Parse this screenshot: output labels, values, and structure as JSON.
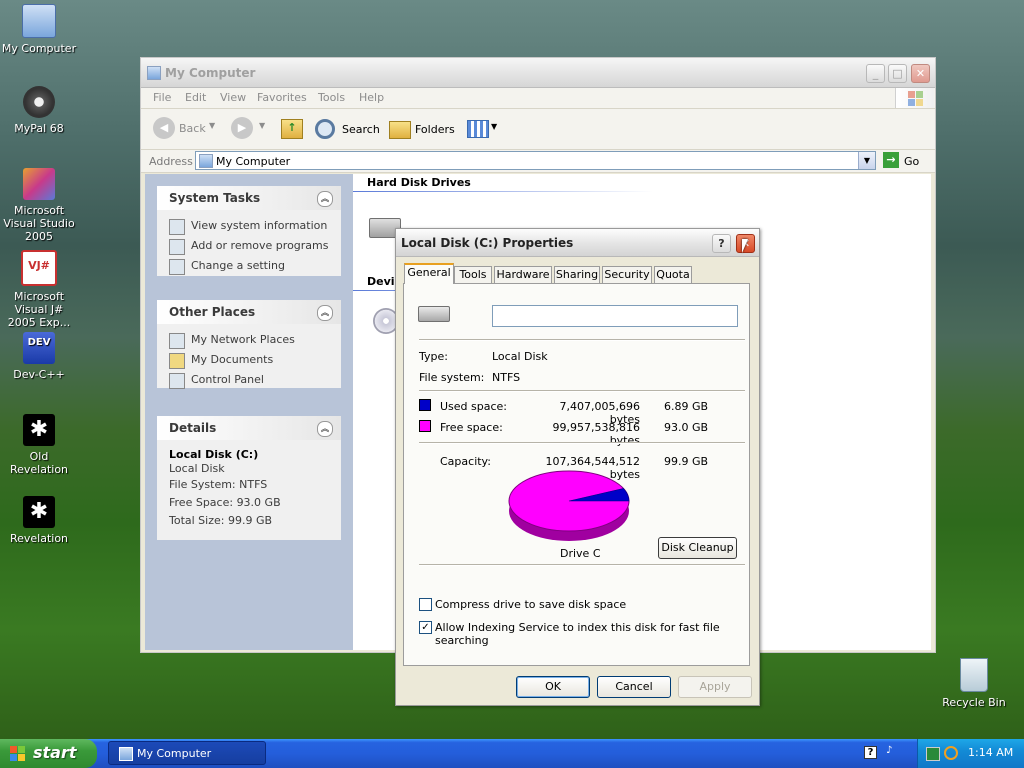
{
  "desktop": {
    "icons": [
      {
        "label": "My Computer"
      },
      {
        "label": "MyPal 68"
      },
      {
        "label": "Microsoft Visual Studio 2005"
      },
      {
        "label": "Microsoft Visual J# 2005 Exp..."
      },
      {
        "label": "Dev-C++"
      },
      {
        "label": "Old Revelation"
      },
      {
        "label": "Revelation"
      },
      {
        "label": "Recycle Bin"
      }
    ]
  },
  "explorer": {
    "title": "My Computer",
    "menu": [
      "File",
      "Edit",
      "View",
      "Favorites",
      "Tools",
      "Help"
    ],
    "toolbar": {
      "back": "Back",
      "search": "Search",
      "folders": "Folders"
    },
    "address": {
      "label": "Address",
      "value": "My Computer",
      "go": "Go"
    },
    "system_tasks": {
      "title": "System Tasks",
      "items": [
        "View system information",
        "Add or remove programs",
        "Change a setting"
      ]
    },
    "other_places": {
      "title": "Other Places",
      "items": [
        "My Network Places",
        "My Documents",
        "Control Panel"
      ]
    },
    "details": {
      "title": "Details",
      "name": "Local Disk (C:)",
      "type": "Local Disk",
      "fs": "File System: NTFS",
      "free": "Free Space: 93.0 GB",
      "total": "Total Size: 99.9 GB"
    },
    "sections": {
      "hdd": "Hard Disk Drives",
      "devices": "Devi"
    }
  },
  "dialog": {
    "title": "Local Disk (C:) Properties",
    "tabs": [
      "General",
      "Tools",
      "Hardware",
      "Sharing",
      "Security",
      "Quota"
    ],
    "name_value": "",
    "type_label": "Type:",
    "type_value": "Local Disk",
    "fs_label": "File system:",
    "fs_value": "NTFS",
    "used": {
      "label": "Used space:",
      "bytes": "7,407,005,696 bytes",
      "gb": "6.89 GB",
      "color": "#0000c8"
    },
    "free": {
      "label": "Free space:",
      "bytes": "99,957,538,816 bytes",
      "gb": "93.0 GB",
      "color": "#ff00ff"
    },
    "capacity": {
      "label": "Capacity:",
      "bytes": "107,364,544,512 bytes",
      "gb": "99.9 GB"
    },
    "used_fraction": 0.069,
    "drive_label": "Drive C",
    "disk_cleanup": "Disk Cleanup",
    "compress": {
      "label": "Compress drive to save disk space",
      "checked": false
    },
    "indexing": {
      "label": "Allow Indexing Service to index this disk for fast file searching",
      "checked": true
    },
    "ok": "OK",
    "cancel": "Cancel",
    "apply": "Apply"
  },
  "taskbar": {
    "start": "start",
    "task": "My Computer",
    "clock": "1:14 AM"
  }
}
